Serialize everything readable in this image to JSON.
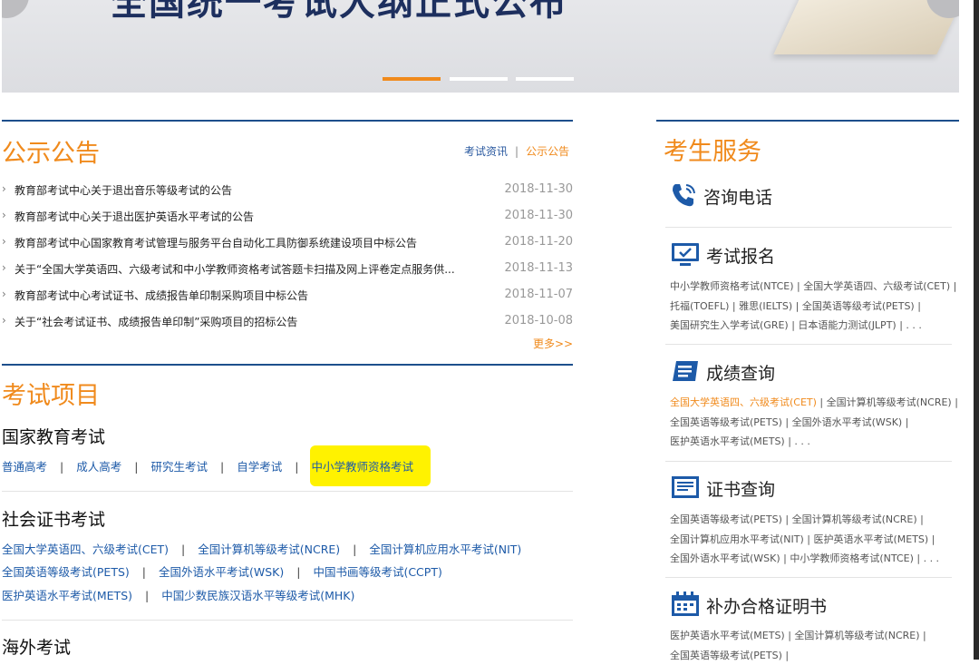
{
  "banner": {
    "headline": "全国统一考试大纲正式公布",
    "slides": 3,
    "active_slide": 1
  },
  "notice": {
    "title": "公示公告",
    "tab_news": "考试资讯",
    "tab_sep": "|",
    "tab_notice": "公示公告",
    "items": [
      {
        "text": "教育部考试中心关于退出音乐等级考试的公告",
        "date": "2018-11-30"
      },
      {
        "text": "教育部考试中心关于退出医护英语水平考试的公告",
        "date": "2018-11-30"
      },
      {
        "text": "教育部考试中心国家教育考试管理与服务平台自动化工具防御系统建设项目中标公告",
        "date": "2018-11-20"
      },
      {
        "text": "关于“全国大学英语四、六级考试和中小学教师资格考试答题卡扫描及网上评卷定点服务供...",
        "date": "2018-11-13"
      },
      {
        "text": "教育部考试中心考试证书、成绩报告单印制采购项目中标公告",
        "date": "2018-11-07"
      },
      {
        "text": "关于“社会考试证书、成绩报告单印制”采购项目的招标公告",
        "date": "2018-10-08"
      }
    ],
    "more": "更多>>"
  },
  "exams": {
    "title": "考试项目",
    "national": {
      "title": "国家教育考试",
      "links": [
        "普通高考",
        "成人高考",
        "研究生考试",
        "自学考试",
        "中小学教师资格考试"
      ]
    },
    "social": {
      "title": "社会证书考试",
      "rows": [
        [
          "全国大学英语四、六级考试(CET)",
          "全国计算机等级考试(NCRE)",
          "全国计算机应用水平考试(NIT)"
        ],
        [
          "全国英语等级考试(PETS)",
          "全国外语水平考试(WSK)",
          "中国书画等级考试(CCPT)"
        ],
        [
          "医护英语水平考试(METS)",
          "中国少数民族汉语水平等级考试(MHK)"
        ]
      ]
    },
    "overseas": {
      "title": "海外考试"
    },
    "sep": "|"
  },
  "services": {
    "title": "考生服务",
    "phone": {
      "title": "咨询电话"
    },
    "register": {
      "title": "考试报名",
      "lines": [
        "中小学教师资格考试(NTCE) | 全国大学英语四、六级考试(CET) |",
        "托福(TOEFL) | 雅思(IELTS) | 全国英语等级考试(PETS) |",
        "美国研究生入学考试(GRE) | 日本语能力测试(JLPT) | . . ."
      ]
    },
    "score": {
      "title": "成绩查询",
      "line1_hl": "全国大学英语四、六级考试(CET)",
      "line1_rest": " | 全国计算机等级考试(NCRE) |",
      "lines": [
        "全国英语等级考试(PETS) | 全国外语水平考试(WSK) |",
        "医护英语水平考试(METS) | . . ."
      ]
    },
    "certificate": {
      "title": "证书查询",
      "lines": [
        "全国英语等级考试(PETS) | 全国计算机等级考试(NCRE) |",
        "全国计算机应用水平考试(NIT) | 医护英语水平考试(METS) |",
        "全国外语水平考试(WSK) | 中小学教师资格考试(NTCE) | . . ."
      ]
    },
    "reissue": {
      "title": "补办合格证明书",
      "lines": [
        "医护英语水平考试(METS)  |  全国计算机等级考试(NCRE) |",
        "全国英语等级考试(PETS) |"
      ]
    }
  },
  "colors": {
    "accent": "#f08a1c",
    "primary": "#1d4f8c",
    "link": "#1d5aa8",
    "highlight": "#fff200"
  }
}
